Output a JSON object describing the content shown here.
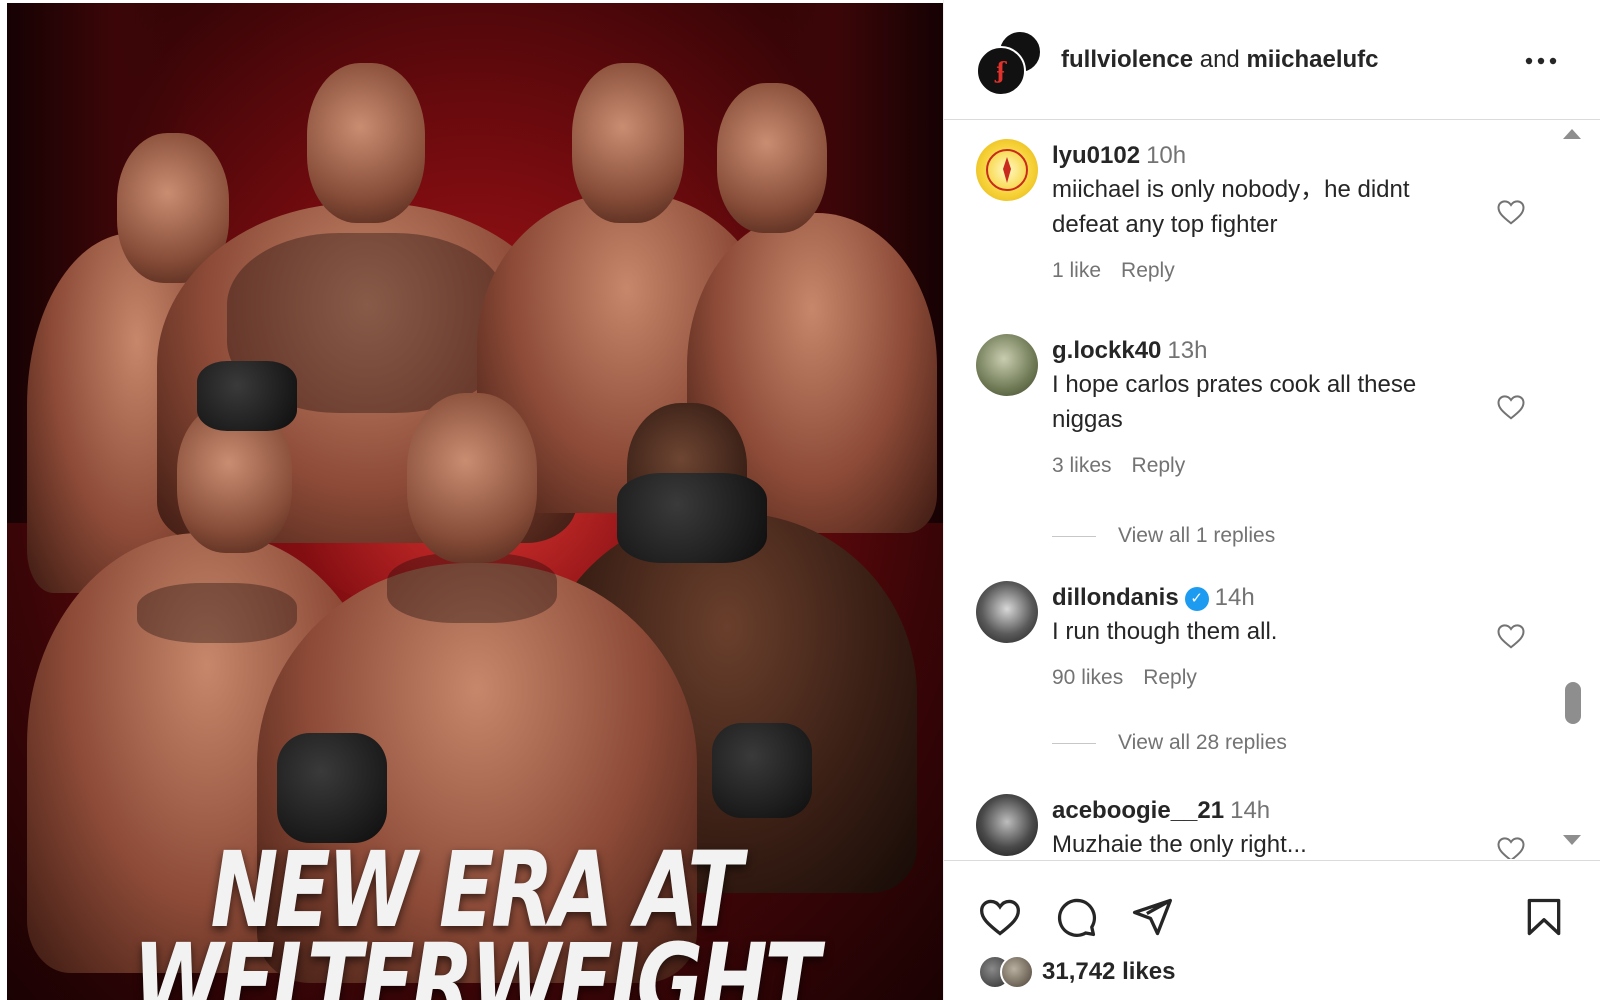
{
  "poster": {
    "title_line1": "NEW ERA AT",
    "title_line2": "WELTERWEIGHT"
  },
  "header": {
    "user1": "fullviolence",
    "connector": "and",
    "user2": "miichaelufc",
    "more_icon": "more-horizontal-icon"
  },
  "comments": [
    {
      "username": "lyu0102",
      "time": "10h",
      "text": "miichael is only nobody，he didnt defeat any top fighter",
      "likes": "1 like",
      "reply": "Reply",
      "view_replies": ""
    },
    {
      "username": "g.lockk40",
      "time": "13h",
      "text": "I hope carlos prates cook all these niggas",
      "likes": "3 likes",
      "reply": "Reply",
      "view_replies": "View all 1 replies"
    },
    {
      "username": "dillondanis",
      "verified": true,
      "time": "14h",
      "text": "I run though them all.",
      "likes": "90 likes",
      "reply": "Reply",
      "view_replies": "View all 28 replies"
    },
    {
      "username": "aceboogie__21",
      "time": "14h",
      "text": "Muzhaie the only right...",
      "likes": "",
      "reply": "",
      "view_replies": ""
    }
  ],
  "actions": {
    "like_icon": "heart-icon",
    "comment_icon": "comment-icon",
    "share_icon": "send-icon",
    "save_icon": "bookmark-icon",
    "likes_count": "31,742 likes"
  },
  "colors": {
    "text": "#262626",
    "muted": "#737373",
    "verified": "#1d9bf0",
    "poster_red": "#b0181b"
  }
}
